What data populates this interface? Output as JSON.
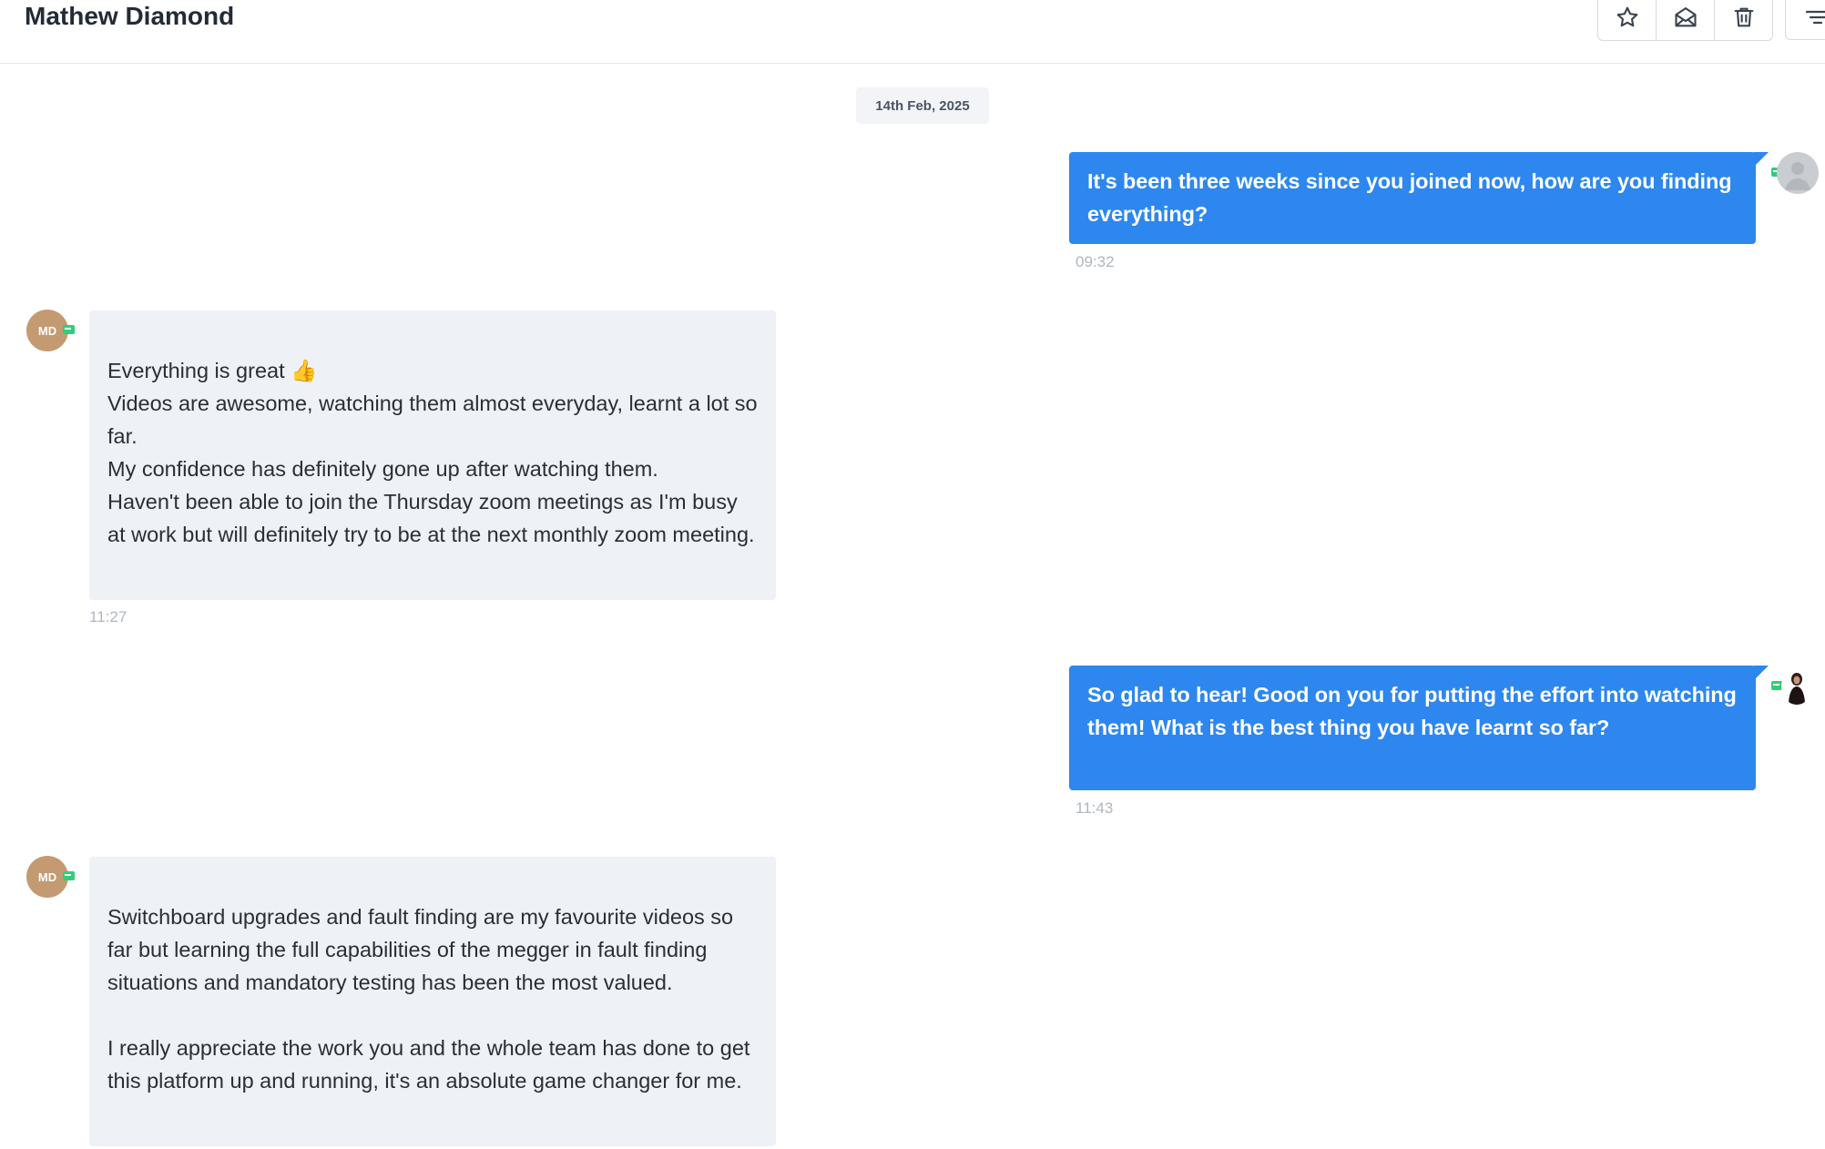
{
  "header": {
    "title": "Mathew Diamond",
    "toolbar": [
      {
        "icon": "star-icon",
        "label": "Star"
      },
      {
        "icon": "envelope-icon",
        "label": "Mark as read"
      },
      {
        "icon": "trash-icon",
        "label": "Delete"
      },
      {
        "icon": "filter-icon",
        "label": "Filter"
      }
    ]
  },
  "conversation": {
    "date_separator": "14th Feb, 2025",
    "contact_initials": "MD",
    "colors": {
      "outgoing": "#2d87ef",
      "incoming": "#eef1f6",
      "online": "#2ecf7a",
      "avatar": "#c49a72"
    },
    "messages": [
      {
        "direction": "outgoing",
        "text": "It's been three weeks since you joined now, how are you finding everything?",
        "time": "09:32"
      },
      {
        "direction": "incoming",
        "text": "Everything is great 👍\nVideos are awesome, watching them almost everyday, learnt a lot so far.\nMy confidence has definitely gone up after watching them.\nHaven't been able to join the Thursday zoom meetings as I'm busy at work but will definitely try to be at the next monthly zoom meeting.",
        "time": "11:27"
      },
      {
        "direction": "outgoing",
        "text": "So glad to hear! Good on you for putting the effort into watching them! What is the best thing you have learnt so far?",
        "time": "11:43"
      },
      {
        "direction": "incoming",
        "text": "Switchboard upgrades and fault finding are my favourite videos so far but learning the full capabilities of the megger in fault finding situations and mandatory testing has been the most valued.\n\nI really appreciate the work you and the whole team has done to get this platform up and running, it's an absolute game changer for me."
      }
    ]
  }
}
